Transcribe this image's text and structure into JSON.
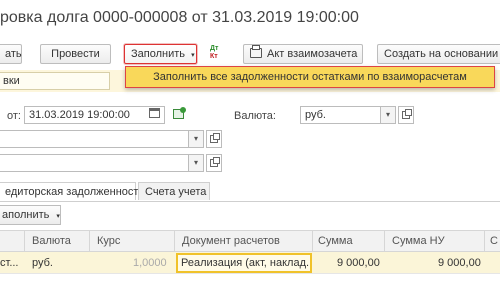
{
  "header": {
    "title": "ровка долга 0000-000008 от 31.03.2019 19:00:00"
  },
  "toolbar": {
    "post_close_label": "ать",
    "post_label": "Провести",
    "fill_label": "Заполнить",
    "dt_label": "Дт",
    "kt_label": "Кт",
    "act_label": "Акт взаимозачета",
    "create_based_label": "Создать на основании"
  },
  "fill_menu": {
    "item": "Заполнить все задолженности остатками по взаиморасчетам"
  },
  "form": {
    "operation_value": "вки",
    "date_label": "от:",
    "date_value": "31.03.2019 19:00:00",
    "currency_label": "Валюта:",
    "currency_value": "руб."
  },
  "tabs": [
    {
      "label": "едиторская задолженность"
    },
    {
      "label": "Счета учета"
    }
  ],
  "table_toolbar": {
    "fill_label": "аполнить"
  },
  "table": {
    "columns": [
      "Валюта",
      "Курс",
      "Документ расчетов",
      "Сумма",
      "Сумма НУ",
      "С"
    ],
    "row": {
      "c0": "ст...",
      "currency": "руб.",
      "rate": "1,0000",
      "document": "Реализация (акт, наклад...",
      "sum": "9 000,00",
      "sum_nu": "9 000,00"
    }
  }
}
